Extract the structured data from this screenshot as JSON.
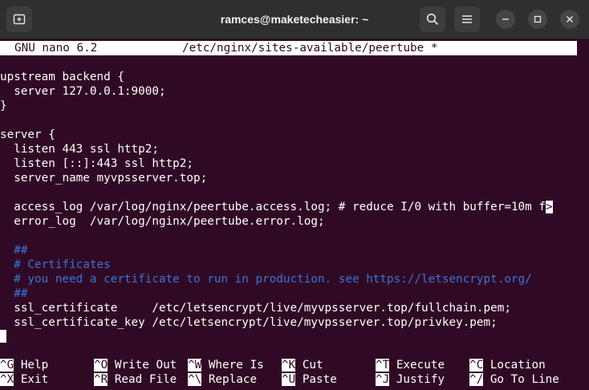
{
  "window": {
    "title": "ramces@maketecheasier: ~"
  },
  "nano": {
    "version": "GNU nano 6.2",
    "filename": "/etc/nginx/sites-available/peertube *"
  },
  "lines": [
    {
      "text": "upstream backend {",
      "type": "code"
    },
    {
      "text": "  server 127.0.0.1:9000;",
      "type": "code"
    },
    {
      "text": "}",
      "type": "code"
    },
    {
      "text": "",
      "type": "code"
    },
    {
      "text": "server {",
      "type": "code"
    },
    {
      "text": "  listen 443 ssl http2;",
      "type": "code"
    },
    {
      "text": "  listen [::]:443 ssl http2;",
      "type": "code"
    },
    {
      "text": "  server_name myvpsserver.top;",
      "type": "code"
    },
    {
      "text": "",
      "type": "code"
    },
    {
      "text": "  access_log /var/log/nginx/peertube.access.log; # reduce I/0 with buffer=10m f",
      "type": "code",
      "truncated": ">"
    },
    {
      "text": "  error_log  /var/log/nginx/peertube.error.log;",
      "type": "code"
    },
    {
      "text": "",
      "type": "code"
    },
    {
      "text": "  ##",
      "type": "comment"
    },
    {
      "text": "  # Certificates",
      "type": "comment"
    },
    {
      "text": "  # you need a certificate to run in production. see https://letsencrypt.org/",
      "type": "comment"
    },
    {
      "text": "  ##",
      "type": "comment"
    },
    {
      "text": "  ssl_certificate     /etc/letsencrypt/live/myvpsserver.top/fullchain.pem;",
      "type": "code"
    },
    {
      "text": "  ssl_certificate_key /etc/letsencrypt/live/myvpsserver.top/privkey.pem;",
      "type": "code"
    }
  ],
  "shortcuts_row1": [
    {
      "key": "^G",
      "label": "Help"
    },
    {
      "key": "^O",
      "label": "Write Out"
    },
    {
      "key": "^W",
      "label": "Where Is"
    },
    {
      "key": "^K",
      "label": "Cut"
    },
    {
      "key": "^T",
      "label": "Execute"
    },
    {
      "key": "^C",
      "label": "Location"
    }
  ],
  "shortcuts_row2": [
    {
      "key": "^X",
      "label": "Exit"
    },
    {
      "key": "^R",
      "label": "Read File"
    },
    {
      "key": "^\\",
      "label": "Replace"
    },
    {
      "key": "^U",
      "label": "Paste"
    },
    {
      "key": "^J",
      "label": "Justify"
    },
    {
      "key": "^/",
      "label": "Go To Line"
    }
  ],
  "colors": {
    "terminal_bg": "#300a24",
    "comment": "#3a74d6",
    "titlebar_bg": "#2f2f2f"
  },
  "icons": [
    "new-tab-icon",
    "search-icon",
    "hamburger-menu-icon",
    "minimize-icon",
    "maximize-icon",
    "close-icon"
  ]
}
